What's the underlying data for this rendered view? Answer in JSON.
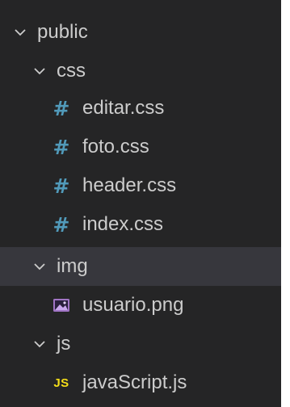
{
  "tree": {
    "public": {
      "label": "public",
      "icon": "chevron-down-icon",
      "children": {
        "css": {
          "label": "css",
          "icon": "chevron-down-icon",
          "files": [
            {
              "label": "editar.css",
              "icon": "css-file-icon"
            },
            {
              "label": "foto.css",
              "icon": "css-file-icon"
            },
            {
              "label": "header.css",
              "icon": "css-file-icon"
            },
            {
              "label": "index.css",
              "icon": "css-file-icon"
            }
          ]
        },
        "img": {
          "label": "img",
          "icon": "chevron-down-icon",
          "selected": true,
          "files": [
            {
              "label": "usuario.png",
              "icon": "image-file-icon"
            }
          ]
        },
        "js": {
          "label": "js",
          "icon": "chevron-down-icon",
          "files": [
            {
              "label": "javaScript.js",
              "icon": "js-file-icon",
              "badge": "JS"
            }
          ]
        }
      }
    }
  },
  "colors": {
    "background": "#252526",
    "selected_row": "#37373d",
    "text": "#cccccc",
    "css_icon": "#519aba",
    "js_icon": "#f5de19",
    "image_icon": "#a074c4"
  }
}
